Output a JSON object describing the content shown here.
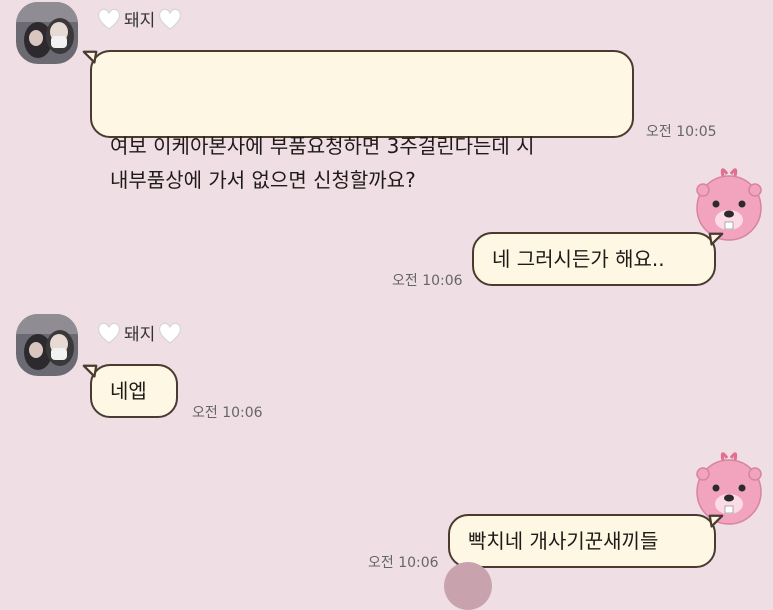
{
  "messages": [
    {
      "sender_name": "돼지",
      "text": "여보 이케아본사에 부품요청하면 3주걸린다는데 시\n내부품상에 가서 없으면 신청할까요?",
      "time": "오전 10:05"
    },
    {
      "text": "네 그러시든가 해요..",
      "time": "오전 10:06"
    },
    {
      "sender_name": "돼지",
      "text": "네엡",
      "time": "오전 10:06"
    },
    {
      "text": "빡치네 개사기꾼새끼들",
      "time": "오전 10:06"
    }
  ],
  "colors": {
    "background": "#efdfe5",
    "bubble_fill": "#fef7e3",
    "bubble_border": "#4a3a30",
    "beaver_pink": "#f2a3bd"
  },
  "icons": {
    "heart": "white-heart-icon",
    "profile": "profile-avatar",
    "beaver": "pink-beaver-avatar"
  }
}
